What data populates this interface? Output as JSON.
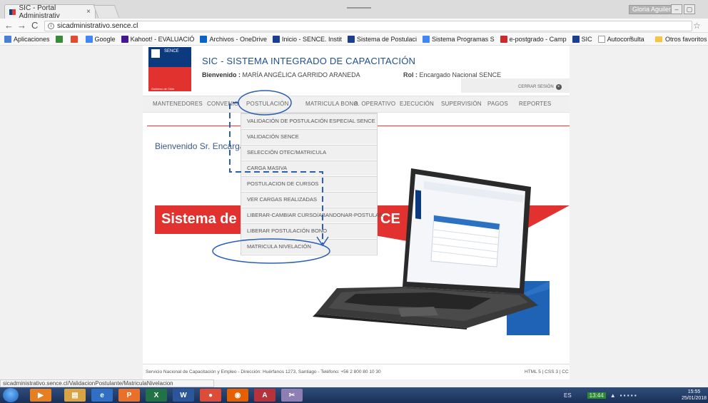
{
  "browser": {
    "tab_title": "SIC - Portal Administrativ",
    "tab_close": "×",
    "window_user": "Gloria Aguilera",
    "url": "sicadministrativo.sence.cl",
    "bookmarks": [
      {
        "label": "Aplicaciones",
        "color": "#4a7fd8"
      },
      {
        "label": "",
        "color": "#3a8a3a"
      },
      {
        "label": "",
        "color": "#e34a2f"
      },
      {
        "label": "Google",
        "color": "#4285f4"
      },
      {
        "label": "Kahoot! - EVALUACIÓ",
        "color": "#46178f"
      },
      {
        "label": "Archivos - OneDrive",
        "color": "#0a64c8"
      },
      {
        "label": "Inicio - SENCE. Instit",
        "color": "#1b3f8f"
      },
      {
        "label": "Sistema de Postulaci",
        "color": "#1b3f8f"
      },
      {
        "label": "Sistema Programas S",
        "color": "#4285f4"
      },
      {
        "label": "e-postgrado - Camp",
        "color": "#c92a2a"
      },
      {
        "label": "SIC",
        "color": "#1b3f8f"
      },
      {
        "label": "Autoconsulta",
        "color": "#999999"
      }
    ],
    "bookmarks_more": "»",
    "other_bookmarks": "Otros favoritos",
    "status_url": "sicadministrativo.sence.cl/ValidacionPostulante/MatriculaNivelacion"
  },
  "header": {
    "logo_text": "SENCE",
    "logo_subtext": "Gobierno de Chile",
    "system_title": "SIC - SISTEMA INTEGRADO DE CAPACITACIÓN",
    "welcome_label": "Bienvenido :",
    "welcome_name": "MARÍA ANGÉLICA GARRIDO ARANEDA",
    "rol_label": "Rol :",
    "rol_value": "Encargado Nacional SENCE",
    "logout_label": "CERRAR SESIÓN"
  },
  "menu": {
    "items": [
      "MANTENEDORES",
      "CONVENIO",
      "POSTULACIÓN",
      "MATRICULA BONO",
      "A. OPERATIVO",
      "EJECUCIÓN",
      "SUPERVISIÓN",
      "PAGOS",
      "REPORTES"
    ]
  },
  "dropdown": {
    "items": [
      "VALIDACIÓN DE POSTULACIÓN ESPECIAL SENCE",
      "VALIDACIÓN SENCE",
      "SELECCIÓN OTEC/MATRICULA",
      "CARGA MASIVA",
      "POSTULACION DE CURSOS",
      "VER CARGAS REALIZADAS",
      "LIBERAR-CAMBIAR CURSO/ABANDONAR-POSTULAR",
      "LIBERAR POSTULACIÓN BONO",
      "MATRICULA NIVELACIÓN"
    ]
  },
  "content": {
    "greeting": "Bienvenido Sr. Encargado",
    "banner_left": "Sistema de",
    "banner_right": "CE"
  },
  "footer": {
    "left": "Servicio Nacional de Capacitación y Empleo - Dirección: Huérfanos 1273, Santiago - Teléfono: +56 2 800 80 10 30",
    "right": "HTML 5 | CSS 3 | CC"
  },
  "taskbar": {
    "lang": "ES",
    "battery": "13:44",
    "time": "15:55",
    "date": "25/01/2018"
  },
  "colors": {
    "accent_blue": "#1d4f91",
    "accent_red": "#e2322f",
    "annotation": "#2b5fb3"
  }
}
